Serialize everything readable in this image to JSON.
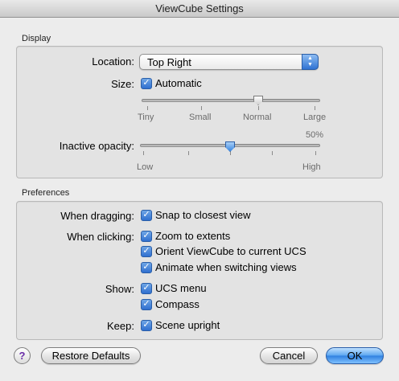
{
  "window": {
    "title": "ViewCube Settings"
  },
  "display": {
    "section_label": "Display",
    "location": {
      "label": "Location:",
      "value": "Top Right",
      "icon": "stepper-arrows-icon"
    },
    "size": {
      "label": "Size:",
      "checkbox_label": "Automatic",
      "checked": true,
      "slider_value": "Normal",
      "ticks": [
        "Tiny",
        "Small",
        "Normal",
        "Large"
      ]
    },
    "opacity": {
      "label": "Inactive opacity:",
      "value_text": "50%",
      "value_percent": 50,
      "low": "Low",
      "high": "High"
    }
  },
  "preferences": {
    "section_label": "Preferences",
    "when_dragging": {
      "label": "When dragging:",
      "options": [
        "Snap to closest view"
      ]
    },
    "when_clicking": {
      "label": "When clicking:",
      "options": [
        "Zoom to extents",
        "Orient ViewCube to current UCS",
        "Animate when switching views"
      ]
    },
    "show": {
      "label": "Show:",
      "options": [
        "UCS menu",
        "Compass"
      ]
    },
    "keep": {
      "label": "Keep:",
      "options": [
        "Scene upright"
      ]
    }
  },
  "buttons": {
    "help": "?",
    "restore": "Restore Defaults",
    "cancel": "Cancel",
    "ok": "OK"
  },
  "colors": {
    "accent": "#3a86e0",
    "help_glyph": "#6a2ca8"
  }
}
